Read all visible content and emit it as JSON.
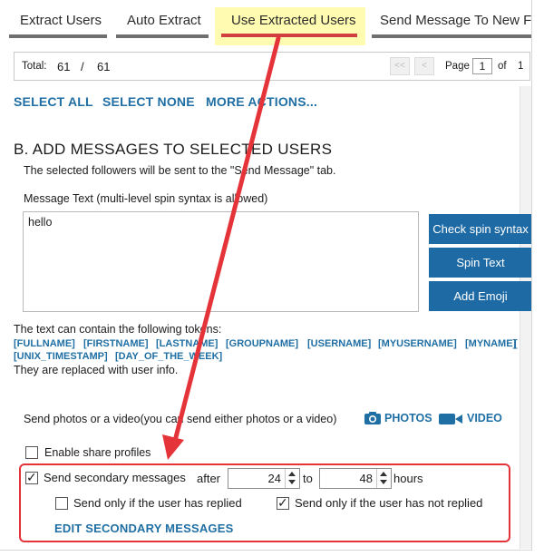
{
  "tabs": [
    {
      "label": "Extract Users"
    },
    {
      "label": "Auto Extract"
    },
    {
      "label": "Use Extracted Users"
    },
    {
      "label": "Send Message To New Fo"
    }
  ],
  "pager": {
    "total_label": "Total:",
    "total_current": "61",
    "separator": "/",
    "total_all": "61",
    "first_btn": "<<",
    "prev_btn": "<",
    "page_label": "Page",
    "page_value": "1",
    "of_label": "of",
    "page_count": "1"
  },
  "actions": {
    "select_all": "SELECT ALL",
    "select_none": "SELECT NONE",
    "more_actions": "MORE ACTIONS..."
  },
  "section": {
    "title": "B. ADD MESSAGES TO SELECTED USERS",
    "subtitle": "The selected followers will be sent to the \"Send Message\" tab.",
    "message_label": "Message Text  (multi-level spin syntax is allowed)",
    "message_value": "hello"
  },
  "buttons": {
    "check_spin": "Check spin syntax",
    "spin_text": "Spin Text",
    "add_emoji": "Add Emoji"
  },
  "tokens": {
    "intro": "The text can contain the following tokens:",
    "row1": [
      "[FULLNAME]",
      "[FIRSTNAME]",
      "[LASTNAME]",
      "[GROUPNAME]",
      "[USERNAME]",
      "[MYUSERNAME]",
      "[MYNAME]",
      "["
    ],
    "row2": [
      "[UNIX_TIMESTAMP]",
      "[DAY_OF_THE_WEEK]"
    ],
    "outro": "They are replaced with user info."
  },
  "media": {
    "label": "Send photos or a video(you can send either photos or a video)",
    "photos": "PHOTOS",
    "video": "VIDEO"
  },
  "options": {
    "share_profiles": "Enable share profiles",
    "share_profiles_checked": false,
    "secondary_label": "Send secondary messages",
    "secondary_checked": true,
    "after_label": "after",
    "after_value": "24",
    "to_label": "to",
    "to_value": "48",
    "unit_label": "hours",
    "replied_label": "Send only if the user has replied",
    "replied_checked": false,
    "not_replied_label": "Send only if the user has not replied",
    "not_replied_checked": true,
    "edit_secondary": "EDIT SECONDARY MESSAGES"
  },
  "colors": {
    "accent": "#1f6fa4",
    "button_bg": "#1e6aa4",
    "highlight": "#fffbb0",
    "annotation_red": "#e5333a"
  }
}
